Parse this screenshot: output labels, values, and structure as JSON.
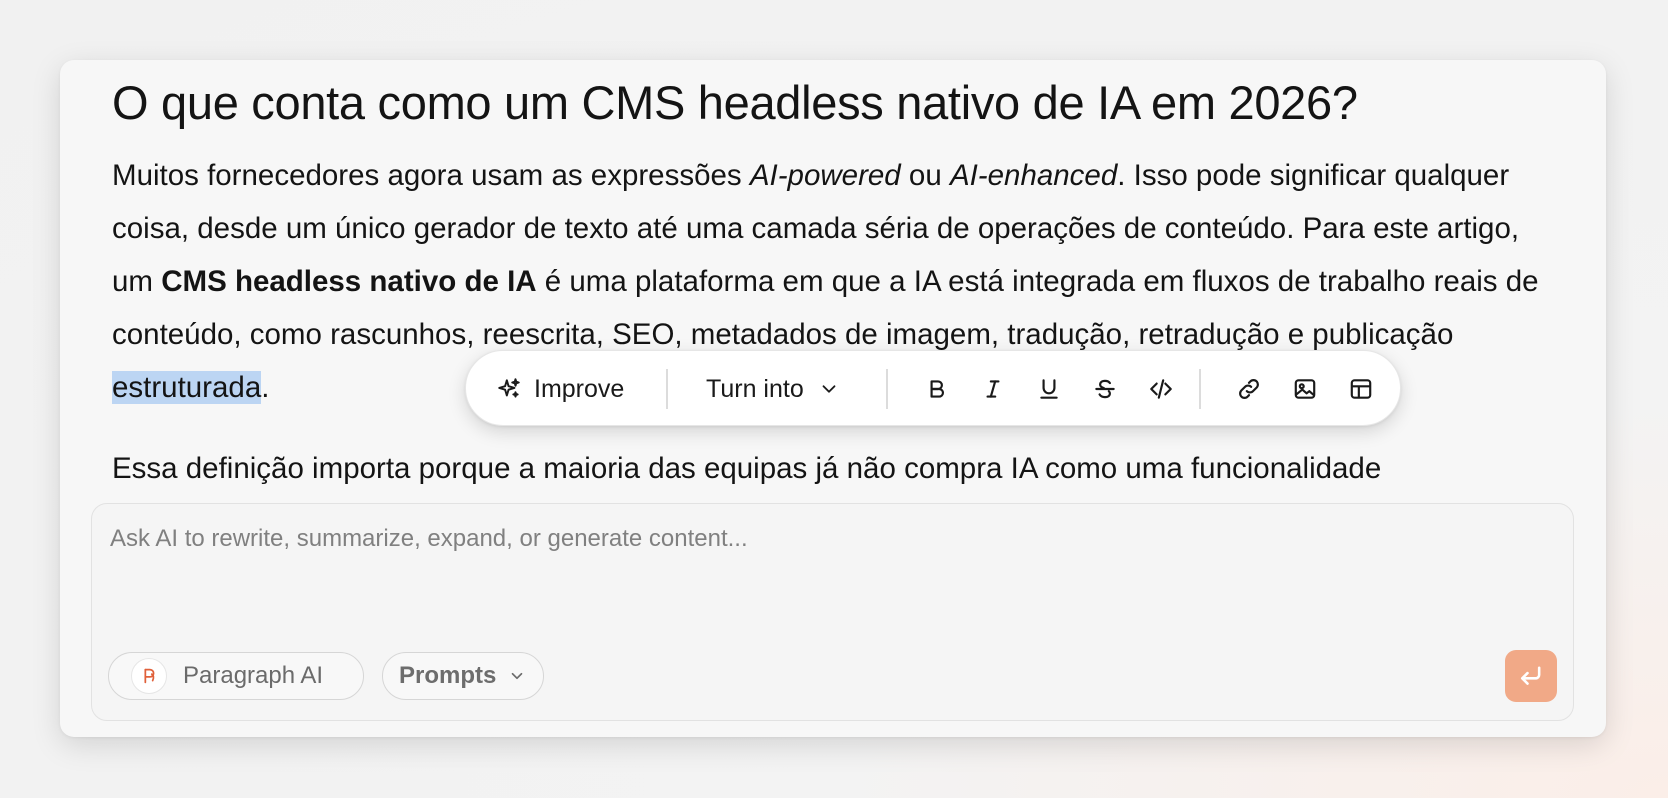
{
  "document": {
    "title": "O que conta como um CMS headless nativo de IA em 2026?",
    "paragraph1": {
      "t1": "Muitos fornecedores agora usam as expressões ",
      "em1": "AI-powered",
      "t2": " ou ",
      "em2": "AI-enhanced",
      "t3": ". Isso pode significar qualquer coisa, desde um único gerador de texto até uma camada séria de operações de conteúdo. Para este artigo, um ",
      "strong": "CMS headless nativo de IA",
      "t4": " é uma plataforma em que a IA está integrada em fluxos de trabalho reais de conteúdo, como rascunhos, reescrita, SEO, metadados de imagem, tradução, retradução e publicação ",
      "selected": "estruturada",
      "t5": "."
    },
    "paragraph2": "Essa definição importa porque a maioria das equipas já não compra IA como uma funcionalidade"
  },
  "toolbar": {
    "improve_label": "Improve",
    "turn_into_label": "Turn into",
    "icons": [
      "sparkles-icon",
      "chevron-down-icon",
      "bold-icon",
      "italic-icon",
      "underline-icon",
      "strikethrough-icon",
      "code-icon",
      "link-icon",
      "image-icon",
      "table-icon"
    ]
  },
  "composer": {
    "placeholder": "Ask AI to rewrite, summarize, expand, or generate content...",
    "value": "",
    "model_label": "Paragraph AI",
    "prompts_label": "Prompts"
  },
  "colors": {
    "accent": "#f1a987",
    "logo": "#e0603a",
    "selection": "#bcd5f3"
  }
}
